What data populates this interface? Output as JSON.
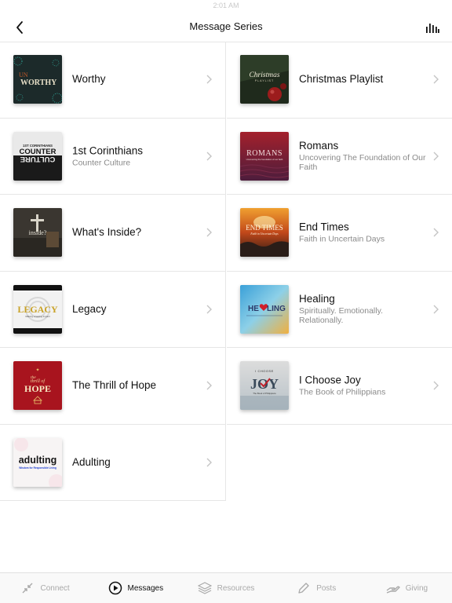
{
  "status_bar": {
    "text": "2:01 AM"
  },
  "nav": {
    "title": "Message Series",
    "back_icon": "chevron-left-icon",
    "stats_icon": "bar-chart-icon"
  },
  "left_column": [
    {
      "title": "Worthy",
      "subtitle": "",
      "art_text": [
        "UN",
        "WORTHY"
      ]
    },
    {
      "title": "1st Corinthians",
      "subtitle": "Counter Culture",
      "art_text": [
        "1ST CORINTHIANS",
        "COUNTER",
        "CULTURE"
      ]
    },
    {
      "title": "What's Inside?",
      "subtitle": "",
      "art_text": [
        "inside?"
      ]
    },
    {
      "title": "Legacy",
      "subtitle": "",
      "art_text": [
        "LEGACY",
        "Making a lasting impact"
      ]
    },
    {
      "title": "The Thrill of Hope",
      "subtitle": "",
      "art_text": [
        "the",
        "thrill of",
        "HOPE"
      ]
    },
    {
      "title": "Adulting",
      "subtitle": "",
      "art_text": [
        "adulting",
        "Wisdom for Responsible Living"
      ]
    }
  ],
  "right_column": [
    {
      "title": "Christmas Playlist",
      "subtitle": "",
      "art_text": [
        "Christmas",
        "PLAYLIST"
      ]
    },
    {
      "title": "Romans",
      "subtitle": "Uncovering The Foundation of Our Faith",
      "art_text": [
        "ROMANS",
        "Uncovering the foundation of our faith"
      ]
    },
    {
      "title": "End Times",
      "subtitle": "Faith in Uncertain Days",
      "art_text": [
        "END TIMES",
        "Faith in Uncertain Days"
      ]
    },
    {
      "title": "Healing",
      "subtitle": "Spiritually. Emotionally. Relationally.",
      "art_text": [
        "HE",
        "LING"
      ]
    },
    {
      "title": "I Choose Joy",
      "subtitle": "The Book of Philippians",
      "art_text": [
        "I CHOOSE",
        "JOY",
        "The Book of Philippians"
      ]
    }
  ],
  "tabs": [
    {
      "label": "Connect",
      "icon": "connect-arrows-icon",
      "active": false
    },
    {
      "label": "Messages",
      "icon": "play-circle-icon",
      "active": true
    },
    {
      "label": "Resources",
      "icon": "layers-icon",
      "active": false
    },
    {
      "label": "Posts",
      "icon": "pencil-icon",
      "active": false
    },
    {
      "label": "Giving",
      "icon": "giving-hand-icon",
      "active": false
    }
  ],
  "colors": {
    "divider": "#e6e6e6",
    "subtitle": "#8a8a8a",
    "tab_inactive": "#a9a9a9",
    "tab_active": "#111111"
  }
}
